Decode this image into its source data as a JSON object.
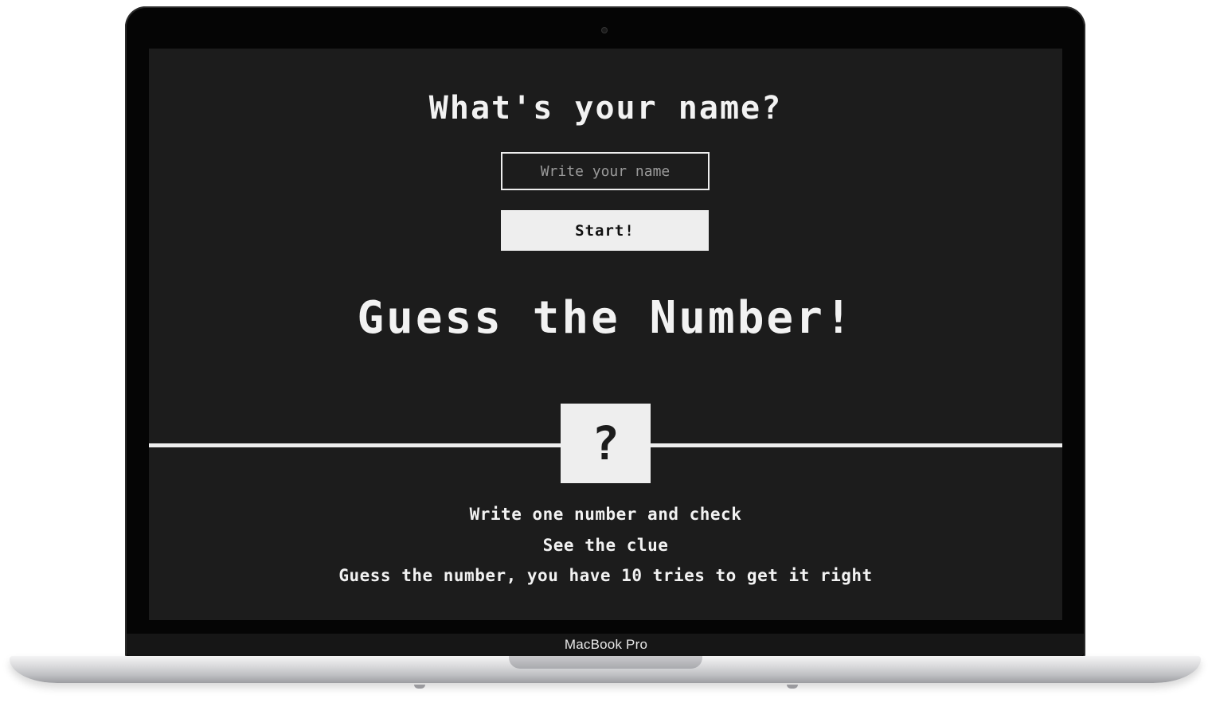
{
  "device": {
    "label": "MacBook Pro"
  },
  "name_section": {
    "title": "What's your name?",
    "input_placeholder": "Write your name",
    "input_value": "",
    "start_label": "Start!"
  },
  "game": {
    "title": "Guess the Number!",
    "secret_symbol": "?",
    "instructions": [
      "Write one number and check",
      "See the clue",
      "Guess the number, you have 10 tries to get it right"
    ]
  },
  "colors": {
    "screen_background": "#1c1c1c",
    "foreground": "#eeeeee"
  }
}
